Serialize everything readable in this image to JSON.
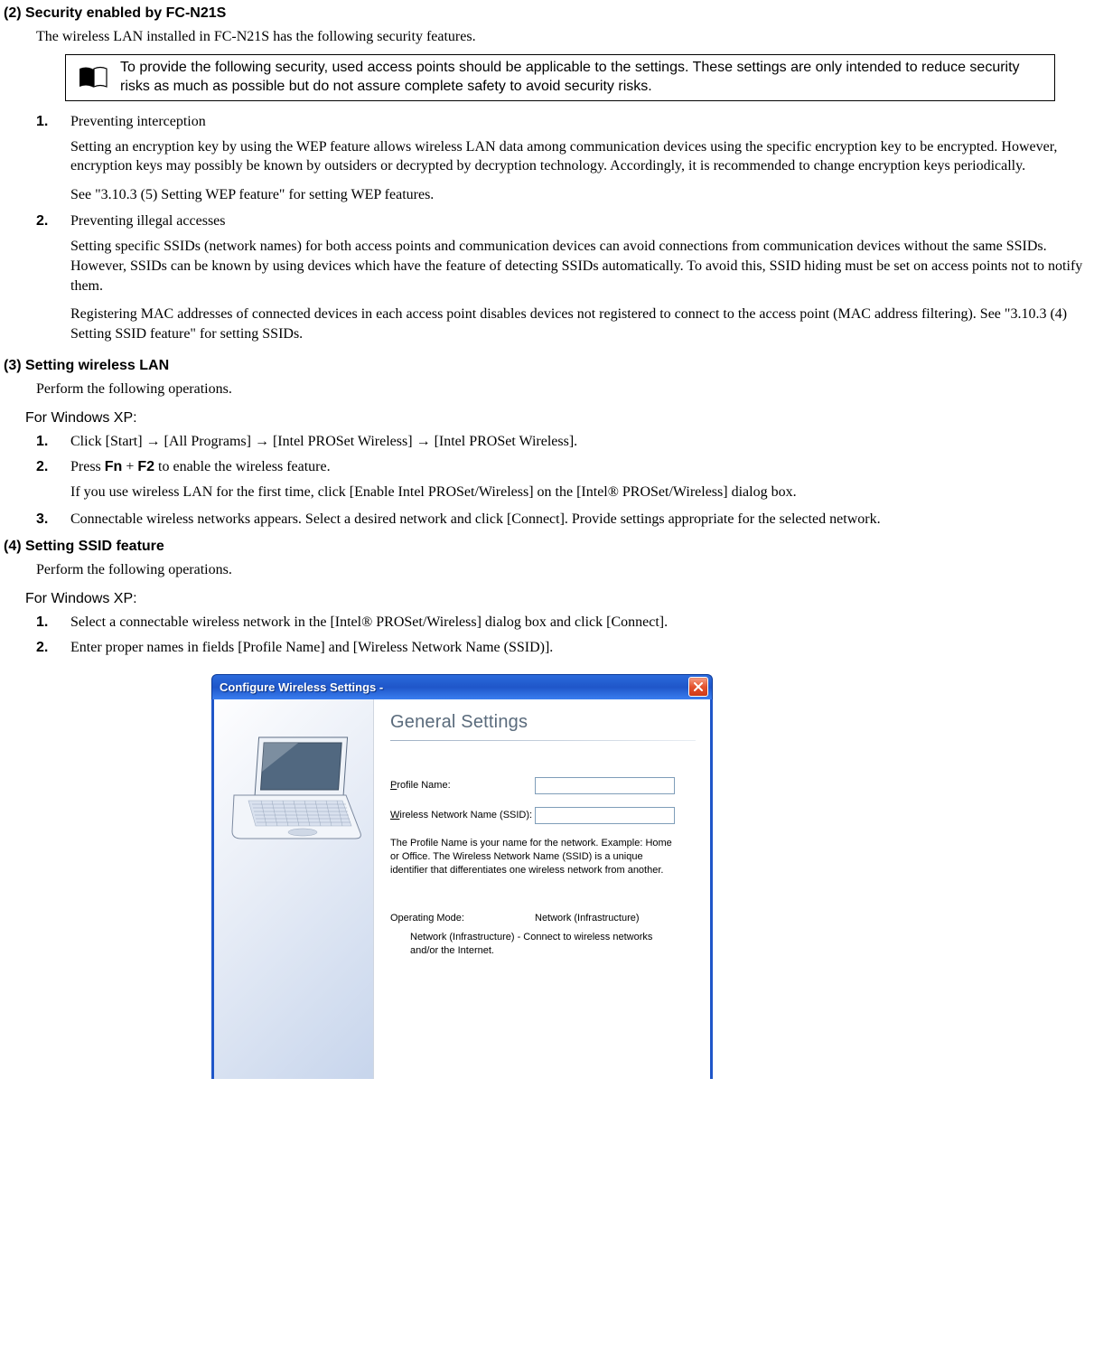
{
  "section2": {
    "heading": "(2) Security enabled by FC-N21S",
    "intro": "The wireless LAN installed in FC-N21S has the following security features.",
    "note": "To provide the following security, used access points should be applicable to the settings. These settings are only intended to reduce security risks as much as possible but do not assure complete safety to avoid security risks.",
    "items": [
      {
        "num": "1.",
        "title": "Preventing interception",
        "paras": [
          "Setting an encryption key by using the WEP feature allows wireless LAN data among communication devices using the specific encryption key to be encrypted. However, encryption keys may possibly be known by outsiders or decrypted by decryption technology. Accordingly, it is recommended to change encryption keys periodically.",
          "See \"3.10.3 (5) Setting WEP feature\" for setting WEP features."
        ]
      },
      {
        "num": "2.",
        "title": "Preventing illegal accesses",
        "paras": [
          "Setting specific SSIDs (network names) for both access points and communication devices can avoid connections from communication devices without the same SSIDs. However, SSIDs can be known by using devices which have the feature of detecting SSIDs automatically. To avoid this, SSID hiding must be set on access points not to notify them.",
          "Registering MAC addresses of connected devices in each access point disables devices not registered to connect to the access point (MAC address filtering). See \"3.10.3 (4) Setting SSID feature\" for setting SSIDs."
        ]
      }
    ]
  },
  "section3": {
    "heading": "(3) Setting wireless LAN",
    "intro": "Perform the following operations.",
    "os_label": "For Windows XP:",
    "items": [
      {
        "num": "1.",
        "html": "Click [Start] → [All Programs] → [Intel PROSet Wireless] → [Intel PROSet Wireless]."
      },
      {
        "num": "2.",
        "html_prefix": "Press ",
        "key1": "Fn",
        "plus": " + ",
        "key2": "F2",
        "html_suffix": " to enable the wireless feature.",
        "para": "If you use wireless LAN for the first time, click [Enable Intel PROSet/Wireless] on the [Intel® PROSet/Wireless] dialog box."
      },
      {
        "num": "3.",
        "html": "Connectable wireless networks appears. Select a desired network and click [Connect]. Provide settings appropriate for the selected network."
      }
    ]
  },
  "section4": {
    "heading": "(4) Setting SSID feature",
    "intro": "Perform the following operations.",
    "os_label": "For Windows XP:",
    "items": [
      {
        "num": "1.",
        "text": "Select a connectable wireless network in the [Intel® PROSet/Wireless] dialog box and click [Connect]."
      },
      {
        "num": "2.",
        "text": "Enter proper names in fields [Profile Name] and [Wireless Network Name (SSID)]."
      }
    ]
  },
  "dialog": {
    "title": "Configure Wireless Settings -",
    "heading": "General Settings",
    "profile_label_u": "P",
    "profile_label_rest": "rofile Name:",
    "ssid_label_u": "W",
    "ssid_label_rest": "ireless Network Name (SSID):",
    "profile_value": "",
    "ssid_value": "",
    "description": "The Profile Name is your name for the network. Example: Home or Office. The Wireless Network Name (SSID) is a unique identifier that differentiates one wireless network from another.",
    "mode_label": "Operating Mode:",
    "mode_value": "Network (Infrastructure)",
    "mode_desc": "Network (Infrastructure) - Connect to wireless networks and/or the Internet."
  }
}
